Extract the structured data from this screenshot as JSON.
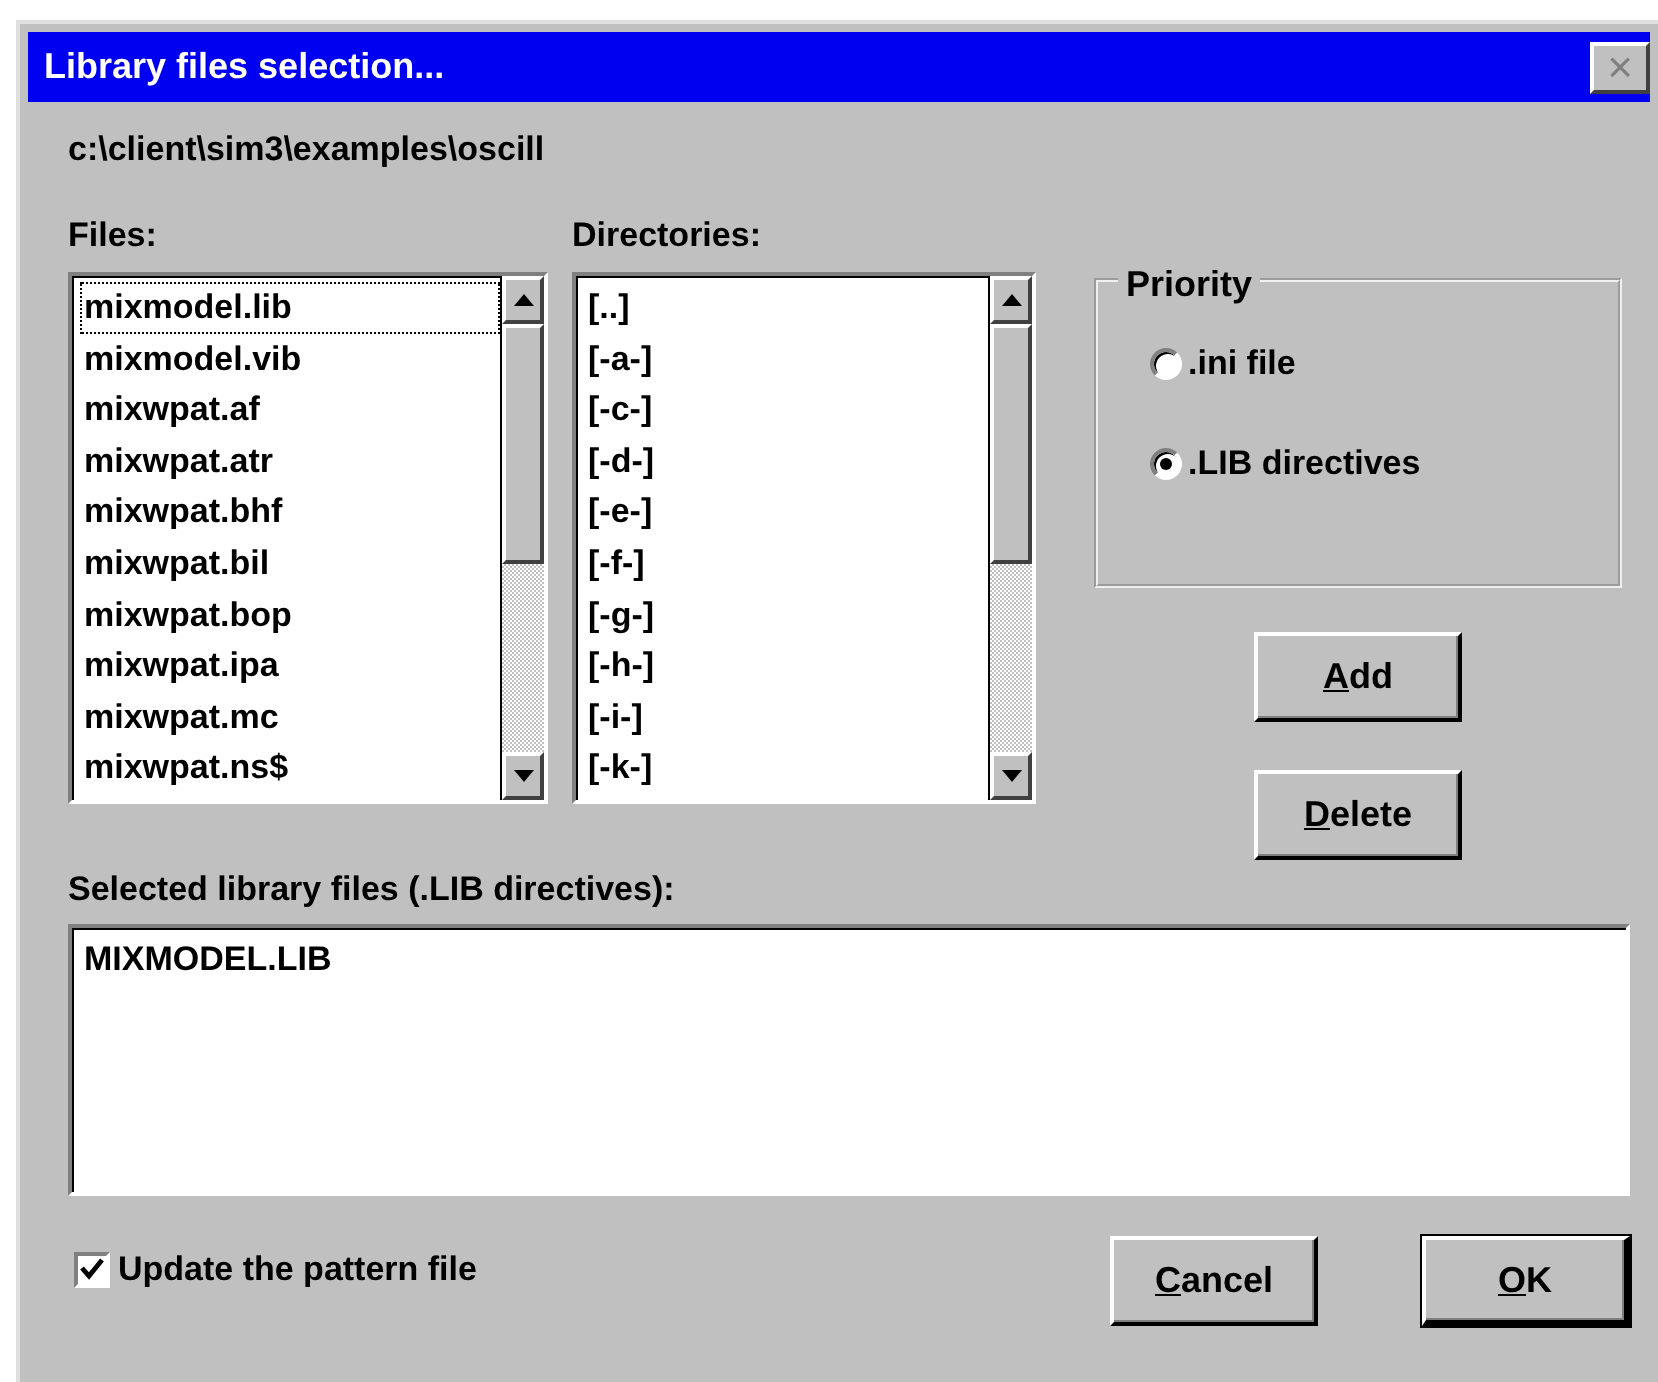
{
  "window": {
    "title": "Library files selection...",
    "close": "×"
  },
  "path": "c:\\client\\sim3\\examples\\oscill",
  "files": {
    "label": "Files:",
    "items": [
      {
        "text": "mixmodel.lib",
        "focused": true
      },
      {
        "text": "mixmodel.vib",
        "focused": false
      },
      {
        "text": "mixwpat.af",
        "focused": false
      },
      {
        "text": "mixwpat.atr",
        "focused": false
      },
      {
        "text": "mixwpat.bhf",
        "focused": false
      },
      {
        "text": "mixwpat.bil",
        "focused": false
      },
      {
        "text": "mixwpat.bop",
        "focused": false
      },
      {
        "text": "mixwpat.ipa",
        "focused": false
      },
      {
        "text": "mixwpat.mc",
        "focused": false
      },
      {
        "text": "mixwpat.ns$",
        "focused": false
      }
    ]
  },
  "directories": {
    "label": "Directories:",
    "items": [
      {
        "text": "[..]",
        "focused": false
      },
      {
        "text": "[-a-]",
        "focused": false
      },
      {
        "text": "[-c-]",
        "focused": false
      },
      {
        "text": "[-d-]",
        "focused": false
      },
      {
        "text": "[-e-]",
        "focused": false
      },
      {
        "text": "[-f-]",
        "focused": false
      },
      {
        "text": "[-g-]",
        "focused": false
      },
      {
        "text": "[-h-]",
        "focused": false
      },
      {
        "text": "[-i-]",
        "focused": false
      },
      {
        "text": "[-k-]",
        "focused": false
      }
    ]
  },
  "priority": {
    "title": "Priority",
    "options": [
      {
        "label": ".ini file",
        "selected": false
      },
      {
        "label": ".LIB directives",
        "selected": true
      }
    ]
  },
  "side_buttons": [
    {
      "label": "Add",
      "underline_first": true
    },
    {
      "label": "Delete",
      "underline_first": true
    }
  ],
  "selected_files": {
    "label": "Selected library files (.LIB directives):",
    "items": [
      "MIXMODEL.LIB"
    ]
  },
  "update_pattern": {
    "label": "Update the pattern file",
    "checked": true
  },
  "buttons": [
    {
      "label": "Cancel",
      "underline_first": true,
      "default": false
    },
    {
      "label": "OK",
      "underline_first": true,
      "default": true
    }
  ]
}
